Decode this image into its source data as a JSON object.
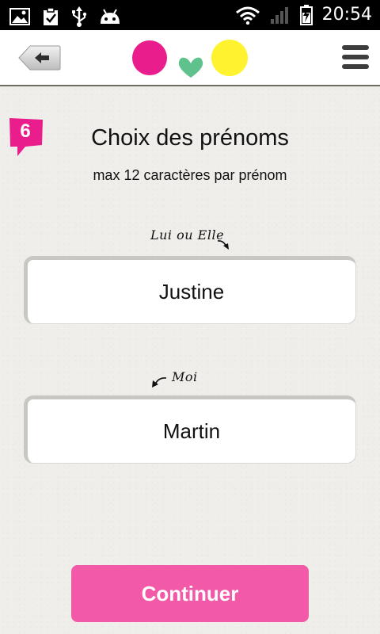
{
  "status_bar": {
    "time": "20:54",
    "icons": [
      "image-icon",
      "clipboard-check-icon",
      "usb-icon",
      "android-icon",
      "wifi-icon",
      "signal-icon",
      "battery-charging-icon"
    ]
  },
  "app_bar": {
    "back_icon": "back-arrow-icon",
    "menu_icon": "hamburger-menu-icon",
    "logo_colors": [
      "#e91e8c",
      "#5fc28c",
      "#fff22e"
    ]
  },
  "step": {
    "number": "6",
    "badge_color": "#e91e8c"
  },
  "title": "Choix des prénoms",
  "subtitle": "max 12 caractères par prénom",
  "partner": {
    "label": "Lui ou Elle",
    "value": "Justine"
  },
  "self": {
    "label": "Moi",
    "value": "Martin"
  },
  "continue_label": "Continuer",
  "accent_color": "#f25aa7"
}
